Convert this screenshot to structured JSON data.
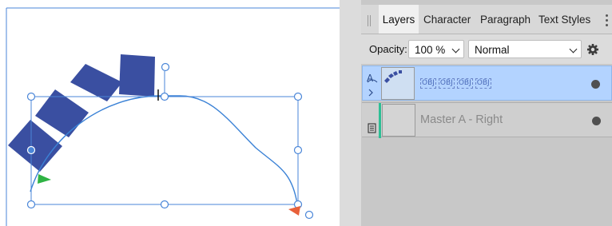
{
  "panel": {
    "tabs": [
      {
        "label": "Layers",
        "active": true
      },
      {
        "label": "Character",
        "active": false
      },
      {
        "label": "Paragraph",
        "active": false
      },
      {
        "label": "Text Styles",
        "active": false
      }
    ],
    "opacity_label": "Opacity:",
    "opacity_value": "100 %",
    "blend_mode": "Normal",
    "layers": [
      {
        "name": "",
        "objects": [
          "OBJ",
          "OBJ",
          "OBJ",
          "OBJ"
        ],
        "selected": true,
        "icon": "text-path-icon",
        "visible": true
      },
      {
        "name": "Master A - Right",
        "selected": false,
        "icon": "master-page-icon",
        "visible": true
      }
    ]
  },
  "colors": {
    "shape_fill": "#3a4fa1",
    "curve": "#3b82d6",
    "selection": "#4a86d8",
    "start_marker": "#2fb344",
    "end_marker": "#e8603a",
    "selected_layer": "#b3d3ff",
    "master_bar": "#2dbf95"
  }
}
